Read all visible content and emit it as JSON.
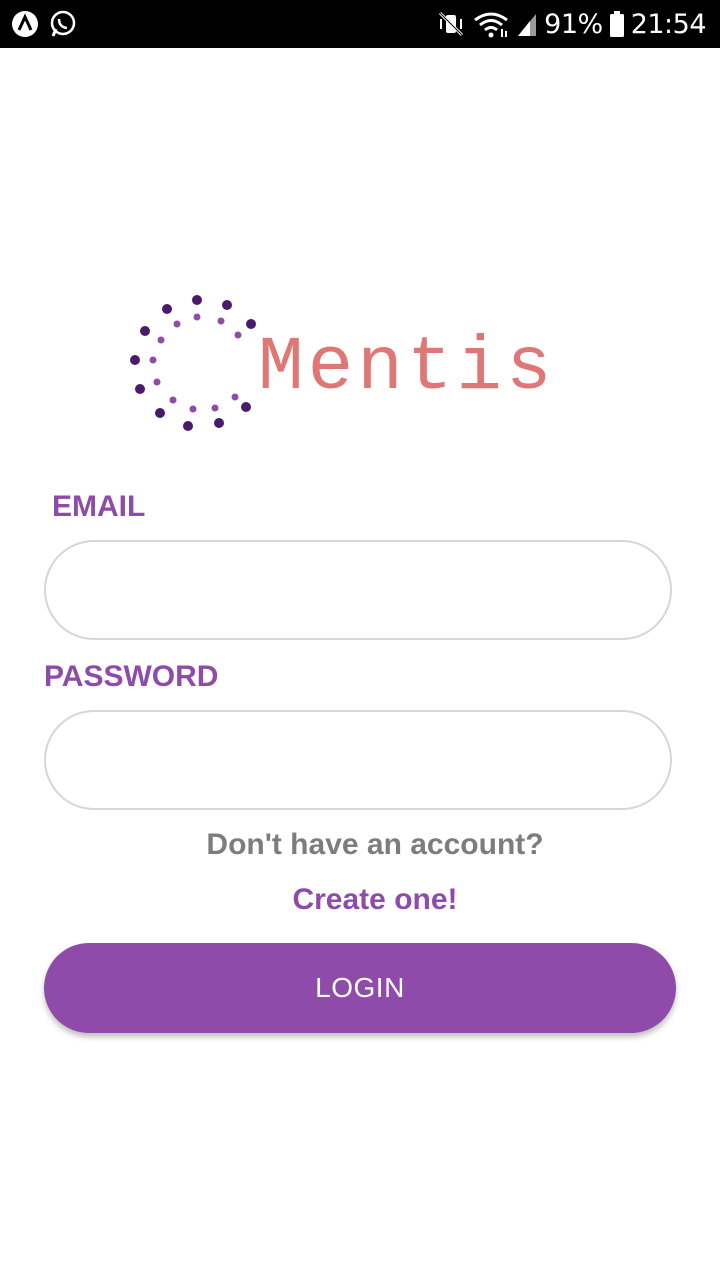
{
  "status_bar": {
    "battery_percent": "91%",
    "time": "21:54",
    "icons": [
      "app-a-icon",
      "whatsapp-icon",
      "vibrate-mute-icon",
      "wifi-icon",
      "signal-icon",
      "battery-icon"
    ]
  },
  "logo": {
    "text": "Mentis",
    "text_color": "#e07777",
    "dot_color": "#4a1a6b",
    "accent_dot_color": "#8e4baa"
  },
  "form": {
    "email_label": "EMAIL",
    "email_value": "",
    "password_label": "PASSWORD",
    "password_value": "",
    "no_account_text": "Don't have an account?",
    "create_link": "Create one!",
    "login_button": "LOGIN"
  },
  "colors": {
    "accent": "#8e4baa",
    "muted_text": "#7d7d7d",
    "input_border": "#d6d6d6"
  }
}
